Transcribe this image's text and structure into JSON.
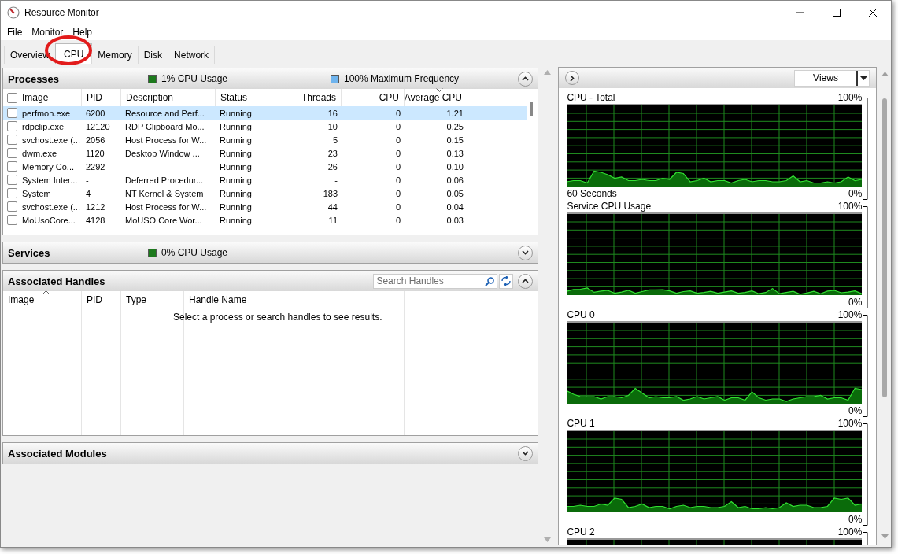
{
  "window": {
    "title": "Resource Monitor"
  },
  "menu": [
    "File",
    "Monitor",
    "Help"
  ],
  "tabs": [
    {
      "label": "Overview",
      "selected": false
    },
    {
      "label": "CPU",
      "selected": true
    },
    {
      "label": "Memory",
      "selected": false
    },
    {
      "label": "Disk",
      "selected": false
    },
    {
      "label": "Network",
      "selected": false
    }
  ],
  "processes": {
    "title": "Processes",
    "expanded": true,
    "all_checked": false,
    "indicators": [
      {
        "label": "1% CPU Usage",
        "color": "#1d7a1d"
      },
      {
        "label": "100% Maximum Frequency",
        "color": "#6fb4ee"
      }
    ],
    "columns": [
      {
        "label": "Image"
      },
      {
        "label": "PID"
      },
      {
        "label": "Description"
      },
      {
        "label": "Status"
      },
      {
        "label": "Threads"
      },
      {
        "label": "CPU"
      },
      {
        "label": "Average CPU",
        "sorted": true
      }
    ],
    "rows": [
      {
        "selected": true,
        "checked": false,
        "cells": [
          "perfmon.exe",
          "6200",
          "Resource and Perf...",
          "Running",
          "16",
          "0",
          "1.21"
        ]
      },
      {
        "selected": false,
        "checked": false,
        "cells": [
          "rdpclip.exe",
          "12120",
          "RDP Clipboard Mo...",
          "Running",
          "10",
          "0",
          "0.25"
        ]
      },
      {
        "selected": false,
        "checked": false,
        "cells": [
          "svchost.exe (...",
          "2056",
          "Host Process for W...",
          "Running",
          "5",
          "0",
          "0.15"
        ]
      },
      {
        "selected": false,
        "checked": false,
        "cells": [
          "dwm.exe",
          "1120",
          "Desktop Window ...",
          "Running",
          "23",
          "0",
          "0.13"
        ]
      },
      {
        "selected": false,
        "checked": false,
        "cells": [
          "Memory Co...",
          "2292",
          "",
          "Running",
          "26",
          "0",
          "0.10"
        ]
      },
      {
        "selected": false,
        "checked": false,
        "cells": [
          "System Inter...",
          "-",
          "Deferred Procedur...",
          "Running",
          "-",
          "0",
          "0.06"
        ]
      },
      {
        "selected": false,
        "checked": false,
        "cells": [
          "System",
          "4",
          "NT Kernel & System",
          "Running",
          "183",
          "0",
          "0.05"
        ]
      },
      {
        "selected": false,
        "checked": false,
        "cells": [
          "svchost.exe (...",
          "1212",
          "Host Process for W...",
          "Running",
          "44",
          "0",
          "0.04"
        ]
      },
      {
        "selected": false,
        "checked": false,
        "cells": [
          "MoUsoCore...",
          "4128",
          "MoUSO Core Wor...",
          "Running",
          "11",
          "0",
          "0.03"
        ]
      }
    ]
  },
  "services": {
    "title": "Services",
    "expanded": false,
    "indicators": [
      {
        "label": "0% CPU Usage",
        "color": "#1d7a1d"
      }
    ]
  },
  "handles": {
    "title": "Associated Handles",
    "expanded": true,
    "search": {
      "placeholder": "Search Handles"
    },
    "columns": [
      {
        "label": "Image",
        "sorted": true
      },
      {
        "label": "PID"
      },
      {
        "label": "Type"
      },
      {
        "label": "Handle Name"
      }
    ],
    "message": "Select a process or search handles to see results."
  },
  "modules": {
    "title": "Associated Modules",
    "expanded": false
  },
  "views_button": "Views",
  "graphs": [
    {
      "title": "CPU - Total",
      "max_label": "100%",
      "time_label": "60 Seconds",
      "min_label": "0%"
    },
    {
      "title": "Service CPU Usage",
      "max_label": "100%",
      "min_label": "0%"
    },
    {
      "title": "CPU 0",
      "max_label": "100%",
      "min_label": "0%"
    },
    {
      "title": "CPU 1",
      "max_label": "100%",
      "min_label": "0%"
    },
    {
      "title": "CPU 2",
      "max_label": "100%"
    }
  ]
}
